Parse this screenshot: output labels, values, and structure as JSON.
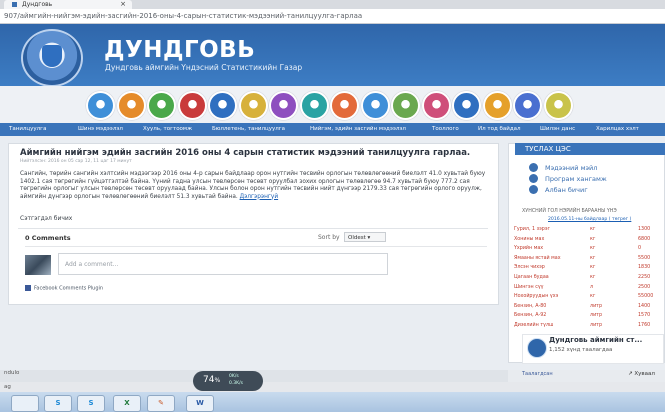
{
  "browser": {
    "tab_title": "Дундговь",
    "tab_close": "×",
    "url": "907/аймгийн-нийгэм-эдийн-засгийн-2016-оны-4-сарын-статистик-мэдээний-танилцуулга-гарлаа"
  },
  "header": {
    "title": "ДУНДГОВЬ",
    "subtitle": "Дундговь аймгийн Үндэсний Статистикийн Газар",
    "brand_color": "#2f66aa"
  },
  "icon_circles": [
    {
      "name": "icon-circle-1",
      "color": "#3f8fd8"
    },
    {
      "name": "icon-circle-2",
      "color": "#e58b2a"
    },
    {
      "name": "icon-circle-3",
      "color": "#4aa84a"
    },
    {
      "name": "icon-circle-4",
      "color": "#c93b3b"
    },
    {
      "name": "icon-circle-5",
      "color": "#2f6fc0"
    },
    {
      "name": "icon-circle-6",
      "color": "#d7b13b"
    },
    {
      "name": "icon-circle-7",
      "color": "#8e4fbf"
    },
    {
      "name": "icon-circle-8",
      "color": "#2aa3a3"
    },
    {
      "name": "icon-circle-9",
      "color": "#e36a3a"
    },
    {
      "name": "icon-circle-10",
      "color": "#3f8fd8"
    },
    {
      "name": "icon-circle-11",
      "color": "#6aa84f"
    },
    {
      "name": "icon-circle-12",
      "color": "#cf4f7a"
    },
    {
      "name": "icon-circle-13",
      "color": "#2f6fc0"
    },
    {
      "name": "icon-circle-14",
      "color": "#e5a02a"
    },
    {
      "name": "icon-circle-15",
      "color": "#4a6fd0"
    },
    {
      "name": "icon-circle-16",
      "color": "#c9c34a"
    }
  ],
  "nav": [
    "Танилцуулга",
    "Шинэ мэдээлэл",
    "Хууль, тогтоомж",
    "Бюллетень, танилцуулга",
    "Нийгэм, эдийн засгийн мэдээлэл",
    "Тооллого",
    "Ил тод байдал",
    "Шилэн данс",
    "Харилцах хэлт"
  ],
  "article": {
    "headline": "Аймгийн нийгэм эдийн засгийн 2016 оны 4 сарын статистик мэдээний танилцуулга гарлаа.",
    "meta": "Нийтэлсэн: 2016 он 05 сар 12, 11 цаг 17 минут",
    "body": "Сангийн, төрийн сангийн хэлтсийн мэдээгээр 2016 оны 4-р сарын байдлаар орон нутгийн төсвийн орлогын төлөвлөгөөний биелэлт 41.0 хувьтай буюу 1402.1 сая төгрөгийн гүйцэтгэлтэй байна. Үүний гадна улсын төвлөрсөн төсөвт оруулбал зохих орлогын төлөвлөгөө 94.7 хувьтай буюу 777.2 сая төгрөгийн орлогыг улсын төвлөрсөн төсөвт оруулаад байна. Улсын болон орон нутгийн төсвийн нийт дүнгээр 2179.33 сая төгрөгийн орлого оруулж, аймгийн дүнгээр орлогын төлөвлөгөөний биелэлт 51.3 хувьтай байна.",
    "more_link": "Дэлгэрэнгүй",
    "source": "Сэтгэгдэл бичих"
  },
  "comments": {
    "count_label": "0 Comments",
    "sort_label": "Sort by",
    "sort_value": "Oldest ▾",
    "input_placeholder": "Add a comment...",
    "plugin_label": "Facebook Comments Plugin"
  },
  "sidebar": {
    "heading": "ТУСЛАХ ЦЭС",
    "links": [
      "Мэдээний мэйл",
      "Програм хангамж",
      "Албан бичиг"
    ],
    "rates_title": "ХУНСНИЙ ГОЛ НЭРИЙН БАРААНЫ ҮНЭ",
    "rates_sub": "2016.05.11-ны байдлаар ( төгрөг )",
    "rates": [
      {
        "name": "Гурил, 1 зэрэг",
        "unit": "кг",
        "price": "1300"
      },
      {
        "name": "Хонины мах",
        "unit": "кг",
        "price": "6800"
      },
      {
        "name": "Үхрийн мах",
        "unit": "кг",
        "price": "0"
      },
      {
        "name": "Ямааны ястай мах",
        "unit": "кг",
        "price": "5500"
      },
      {
        "name": "Элсэн чихэр",
        "unit": "кг",
        "price": "1830"
      },
      {
        "name": "Цагаан будаа",
        "unit": "кг",
        "price": "2250"
      },
      {
        "name": "Шингэн сүү",
        "unit": "л",
        "price": "2500"
      },
      {
        "name": "Нохойруудын үхэ",
        "unit": "кг",
        "price": "55000"
      },
      {
        "name": "Бензин, А-80",
        "unit": "литр",
        "price": "1400"
      },
      {
        "name": "Бензин, А-92",
        "unit": "литр",
        "price": "1570"
      },
      {
        "name": "Дизелийн түлш",
        "unit": "литр",
        "price": "1760"
      }
    ],
    "fb_page_name": "Дундговь аймгийн ст...",
    "fb_likes": "1,152 хүнд таалагдаа",
    "share_left": "Таалагдсан",
    "share_right": "↗ Хуваал"
  },
  "status": {
    "left_top": "ndulo",
    "left_bottom": "ag"
  },
  "zoom": {
    "value": "74",
    "unit": "%",
    "up": "0K/s",
    "down": "0.3K/s"
  },
  "taskbar": [
    {
      "label": "",
      "color": "#3a6fb0"
    },
    {
      "label": "S",
      "color": "#1e8ad6"
    },
    {
      "label": "S",
      "color": "#1e8ad6"
    },
    {
      "label": "X",
      "color": "#1f7a3a"
    },
    {
      "label": "✎",
      "color": "#c85a2a"
    },
    {
      "label": "W",
      "color": "#2a5aa6"
    }
  ]
}
